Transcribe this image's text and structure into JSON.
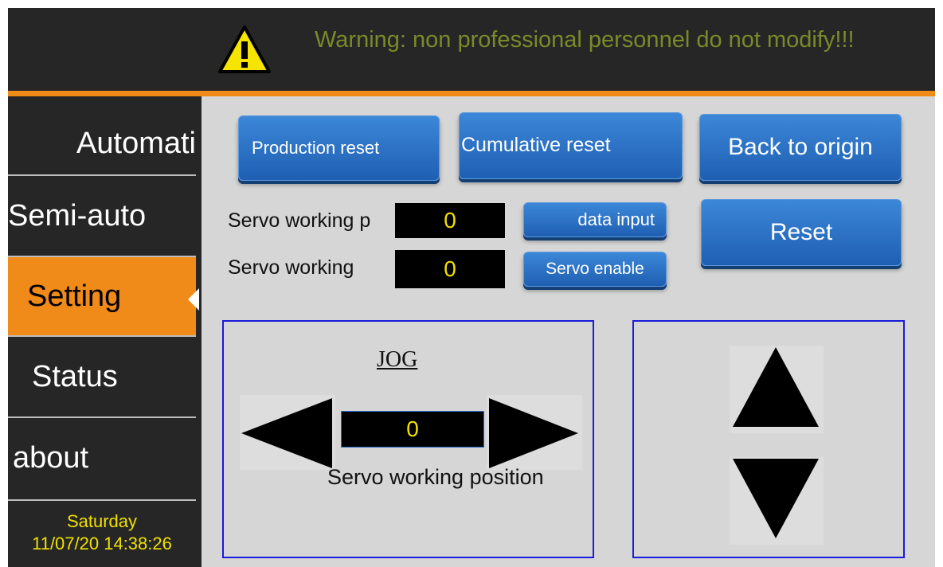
{
  "header": {
    "warning_text": "Warning: non professional personnel do not modify!!!",
    "warning_icon": "warning-triangle-icon"
  },
  "sidebar": {
    "items": [
      {
        "label": "Automati",
        "active": false
      },
      {
        "label": "Semi-auto",
        "active": false
      },
      {
        "label": "Setting",
        "active": true
      },
      {
        "label": "Status",
        "active": false
      },
      {
        "label": "about",
        "active": false
      }
    ],
    "day": "Saturday",
    "datetime": "11/07/20 14:38:26"
  },
  "buttons": {
    "production_reset": "Production reset",
    "cumulative_reset": "Cumulative reset",
    "back_to_origin": "Back to origin",
    "data_input": "data input",
    "servo_enable": "Servo enable",
    "reset": "Reset"
  },
  "fields": {
    "servo_label_1": "Servo working p",
    "servo_value_1": "0",
    "servo_label_2": "Servo working",
    "servo_value_2": "0"
  },
  "jog": {
    "title": "JOG",
    "value": "0",
    "caption": "Servo working position"
  },
  "colors": {
    "accent": "#f08a18",
    "button": "#2a6fc4",
    "value_text": "#f0e000",
    "panel_border": "#1b1bdd",
    "warning_text": "#7a8a2a"
  }
}
